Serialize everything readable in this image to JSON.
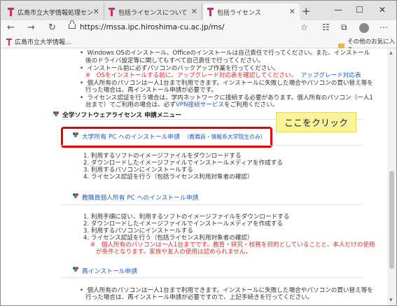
{
  "tabs": [
    {
      "label": "広島市立大学情報処理センター"
    },
    {
      "label": "包括ライセンスについて"
    },
    {
      "label": "包括ライセンス"
    }
  ],
  "new_tab": "+",
  "window": {
    "minimize": "—",
    "maximize": "☐",
    "close": "✕"
  },
  "address": {
    "url": "https://mssa.ipc.hiroshima-cu.ac.jp/ms/"
  },
  "favorites": {
    "item": "広島市立大学情報...",
    "other": "その他のお気に入り"
  },
  "top_list": {
    "b1_l1": "Windows OSのインストール、Officeのインストールは自己責任で行ってください。また、インストール",
    "b1_l2": "後のドライバ設定等に関してもすべて自己責任で行ってください。",
    "b2": "インストール前に必ずパソコンのバックアップ作業を行ってください。",
    "b2_note": "※　OSをインストールする前に、アップグレード対応表を確認してください。",
    "b2_link": "アップグレード対応表",
    "b3_l1": "個人所有のパソコンは一人1台まで利用できます。インストールに失敗した場合やパソコンの買い替え等を",
    "b3_l2": "行った場合は、再インストール申請が必要です。",
    "b4_l1": "ライセンス認証を行う場合は、学内ネットワークに接続する必要があります。個人所有のパソコン（一人1",
    "b4_l2a": "台まで）でご利用の場合は、必ず",
    "b4_l2_link": "VPN接続サービス",
    "b4_l2b": "をご利用ください。"
  },
  "menu_header": "全学ソフトウェアライセンス 申請メニュー",
  "section1": {
    "title": "大学所有 PC へのインストール申請",
    "note": "（教職員・情報系大学院生のみ）",
    "steps": [
      "1. 利用するソフトのイメージファイルをダウンロードする",
      "2. ダウンロードしたイメージファイルでインストールメディアを作成する",
      "3. 利用するパソコンにインストールする",
      "4. ライセンス認証を行う（包括ライセンス利用対象者の確認）"
    ]
  },
  "callout": "ここをクリック",
  "section2": {
    "title": "教職員個人所有 PC へのインストール申請",
    "steps": [
      "1. 利用手順に従い、利用するソフトのイメージファイルをダウンロードする",
      "2. ダウンロードしたイメージファイルでインストールメディアを作成する",
      "3. 利用するパソコンにインストールする",
      "4. ライセンス認証を行う（包括ライセンス利用対象者の確認）"
    ],
    "warn_l1": "※　個人所有のパソコンは一人1台までです。教育・研究・校務を目的としていることと、本人だけの使用",
    "warn_l2": "が条件となります。家族や友人の使用は認められません。"
  },
  "section3": {
    "title": "再インストール申請",
    "b1_l1": "個人所有のパソコンは一人1台まで利用できます。インストールに失敗した場合やパソコンの買い替え等を",
    "b1_l2": "行った場合は、再インストール申請が必要ですので、上記手続きを行ってください。"
  },
  "colors": {
    "accent_link": "#1f5fc0",
    "warning": "#e03030",
    "highlight_box": "#e30000",
    "callout_bg": "#fbf39c",
    "tab_brand": "#d6246e"
  }
}
